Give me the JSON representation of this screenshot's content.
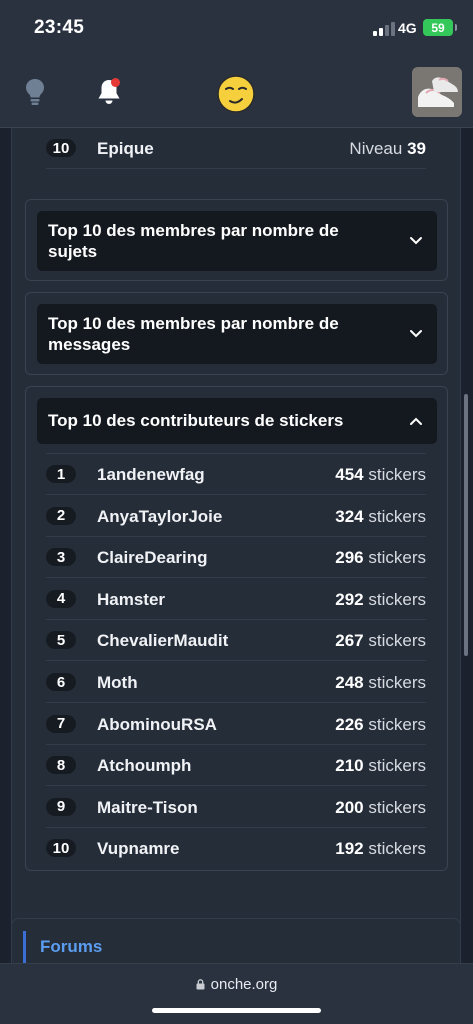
{
  "status": {
    "time": "23:45",
    "network": "4G",
    "battery": "59"
  },
  "nav": {
    "idea_icon": "lightbulb-icon",
    "notif_icon": "bell-icon",
    "logo_icon": "smiley-icon",
    "avatar": "profile-avatar"
  },
  "levels_last": {
    "rank": "10",
    "name": "Epique",
    "label": "Niveau",
    "level": "39"
  },
  "sections": {
    "topics": {
      "title": "Top 10 des membres par nombre de sujets",
      "icon": "chevron-down-icon"
    },
    "messages": {
      "title": "Top 10 des membres par nombre de messages",
      "icon": "chevron-down-icon"
    },
    "stickers": {
      "title": "Top 10 des contributeurs de stickers",
      "icon": "chevron-up-icon"
    }
  },
  "sticker_unit": "stickers",
  "stickers_list": [
    {
      "rank": "1",
      "name": "1andenewfag",
      "count": "454"
    },
    {
      "rank": "2",
      "name": "AnyaTaylorJoie",
      "count": "324"
    },
    {
      "rank": "3",
      "name": "ClaireDearing",
      "count": "296"
    },
    {
      "rank": "4",
      "name": "Hamster",
      "count": "292"
    },
    {
      "rank": "5",
      "name": "ChevalierMaudit",
      "count": "267"
    },
    {
      "rank": "6",
      "name": "Moth",
      "count": "248"
    },
    {
      "rank": "7",
      "name": "AbominouRSA",
      "count": "226"
    },
    {
      "rank": "8",
      "name": "Atchoumph",
      "count": "210"
    },
    {
      "rank": "9",
      "name": "Maitre-Tison",
      "count": "200"
    },
    {
      "rank": "10",
      "name": "Vupnamre",
      "count": "192"
    }
  ],
  "forums": {
    "title": "Forums"
  },
  "browser": {
    "url": "onche.org"
  },
  "colors": {
    "accent": "#5b9df0",
    "notification": "#e53935",
    "battery": "#34c759"
  }
}
